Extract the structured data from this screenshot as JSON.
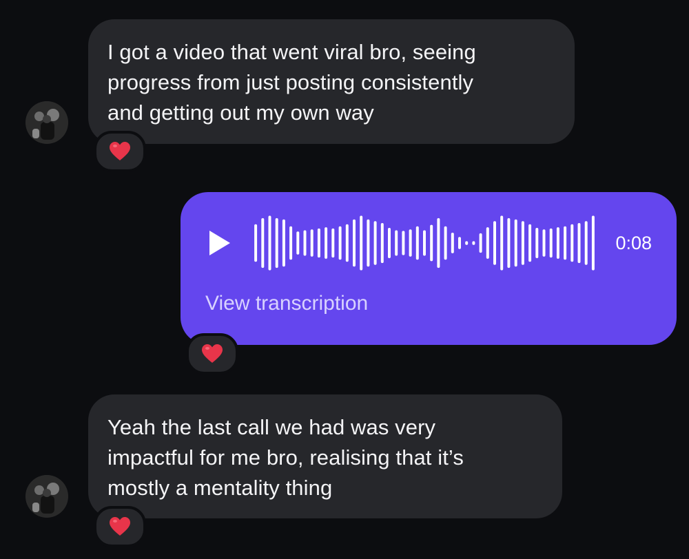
{
  "messages": [
    {
      "lines": [
        "I got a video that went viral bro, seeing",
        "progress from just posting consistently",
        "and getting out my own way"
      ],
      "reaction": "red-heart"
    },
    {
      "type": "voice",
      "duration": "0:08",
      "transcription_link": "View transcription",
      "reaction": "red-heart"
    },
    {
      "lines": [
        "Yeah the last call we had was very",
        "impactful for me bro, realising that it’s",
        "mostly a mentality thing"
      ],
      "reaction": "red-heart"
    }
  ],
  "colors": {
    "background": "#0c0d10",
    "incoming_bubble": "#26272b",
    "outgoing_bubble": "#6446ee",
    "heart": "#e8354a"
  },
  "icons": [
    "avatar",
    "play-icon",
    "waveform",
    "heart-icon"
  ]
}
